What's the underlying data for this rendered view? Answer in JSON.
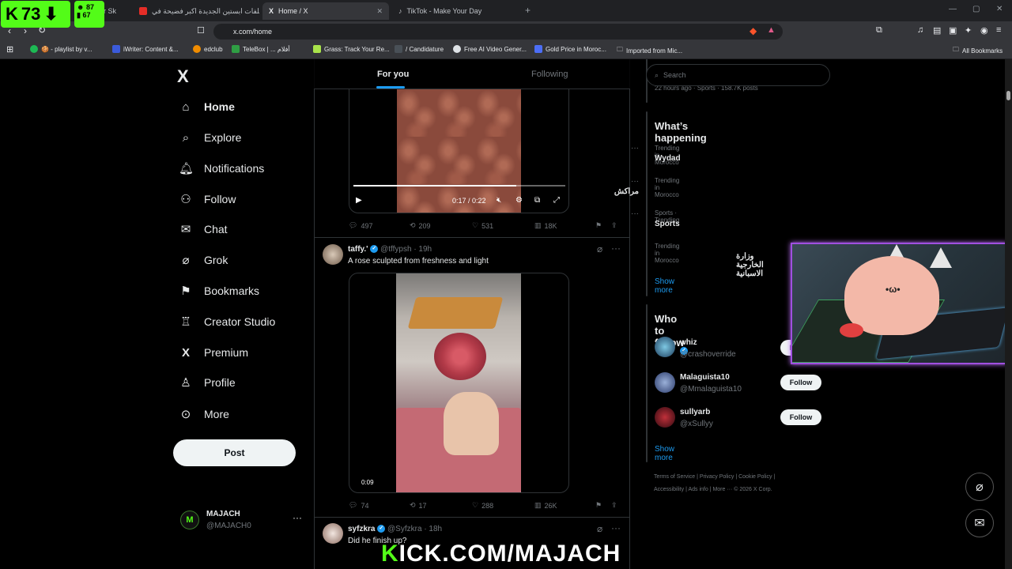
{
  "browser": {
    "tabs": [
      {
        "label": "er Sk",
        "active": false
      },
      {
        "label": "ملفات ابستين الجديدة اكبر فضيحة في",
        "active": false
      },
      {
        "label": "Home / X",
        "active": true
      },
      {
        "label": "TikTok - Make Your Day",
        "active": false
      }
    ],
    "url": "x.com/home",
    "bookmarks": [
      "🍪 - playlist by v...",
      "iWriter: Content &...",
      "edclub",
      "TeleBox | ... أفلام",
      "Grass: Track Your Re...",
      "/ Candidature",
      "Free AI Video Gener...",
      "Gold Price in Moroc...",
      "Imported from Mic..."
    ],
    "all_bookmarks": "All Bookmarks"
  },
  "overlay": {
    "kick_letter": "K",
    "viewer_count": "73",
    "stat_top": "87",
    "stat_bottom": "67",
    "banner_k": "K",
    "banner_rest": "ICK.COM/MAJACH"
  },
  "nav": {
    "logo": "X",
    "items": [
      {
        "label": "Home",
        "icon": "home-icon"
      },
      {
        "label": "Explore",
        "icon": "search-icon"
      },
      {
        "label": "Notifications",
        "icon": "bell-icon"
      },
      {
        "label": "Follow",
        "icon": "person-plus-icon"
      },
      {
        "label": "Chat",
        "icon": "mail-icon"
      },
      {
        "label": "Grok",
        "icon": "grok-icon"
      },
      {
        "label": "Bookmarks",
        "icon": "bookmark-icon"
      },
      {
        "label": "Creator Studio",
        "icon": "creator-icon"
      },
      {
        "label": "Premium",
        "icon": "x-icon"
      },
      {
        "label": "Profile",
        "icon": "person-icon"
      },
      {
        "label": "More",
        "icon": "more-circle-icon"
      }
    ],
    "post_label": "Post",
    "account": {
      "name": "MAJACH",
      "handle": "@MAJACH0"
    }
  },
  "feed": {
    "tabs": {
      "for_you": "For you",
      "following": "Following"
    },
    "video1": {
      "time": "0:17 / 0:22",
      "progress": 0.77
    },
    "post1_stats": {
      "replies": "497",
      "reposts": "209",
      "likes": "531",
      "views": "18K"
    },
    "post2": {
      "name": "taffy.'",
      "handle": "@tffypsh",
      "age": "· 19h",
      "text": "A rose sculpted from freshness and light",
      "video_time": "0:09",
      "stats": {
        "replies": "74",
        "reposts": "17",
        "likes": "288",
        "views": "26K"
      }
    },
    "post3": {
      "name": "syfzkra",
      "handle": "@Syfzkra",
      "age": "· 18h",
      "text": "Did he finish up?"
    }
  },
  "sidebar": {
    "search_placeholder": "Search",
    "prev_meta": "22 hours ago · Sports · 158.7K posts",
    "happening_title": "What’s happening",
    "trends": [
      {
        "meta": "Trending in Morocco",
        "name": "Wydad"
      },
      {
        "meta": "Trending in Morocco",
        "name": "مراكش"
      },
      {
        "meta": "Sports · Trending",
        "name": "Sports"
      },
      {
        "meta": "Trending in Morocco",
        "name": "وزارة الخارجية الاسبانية"
      }
    ],
    "show_more": "Show more",
    "wtf_title": "Who to follow",
    "follow_label": "Follow",
    "who_to_follow": [
      {
        "name": "whiz",
        "handle": "@crashoverride",
        "verified": true
      },
      {
        "name": "Malaguista10",
        "handle": "@Mmalaguista10",
        "verified": false
      },
      {
        "name": "sullyarb",
        "handle": "@xSullyy",
        "verified": false
      }
    ],
    "footer_line1": "Terms of Service  |  Privacy Policy  |  Cookie Policy  |",
    "footer_line2": "Accessibility  |  Ads info  |  More ···  © 2026 X Corp."
  },
  "colors": {
    "accent": "#1d9bf0",
    "kick": "#53fc18",
    "background": "#000000"
  }
}
